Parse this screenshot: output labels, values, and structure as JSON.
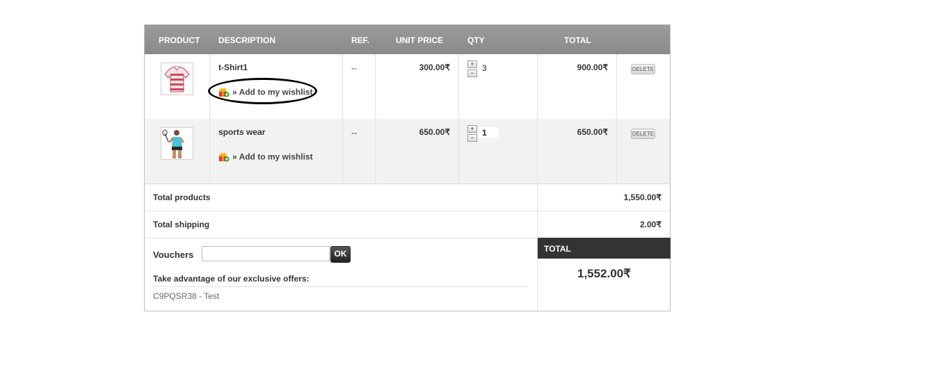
{
  "headers": {
    "product": "PRODUCT",
    "description": "DESCRIPTION",
    "ref": "REF.",
    "unit_price": "UNIT PRICE",
    "qty": "QTY",
    "total": "TOTAL"
  },
  "items": [
    {
      "image_icon": "tshirt-striped-thumbnail",
      "name": "t-Shirt1",
      "wishlist": "» Add to my wishlist",
      "ref": "--",
      "unit_price": "300.00₹",
      "qty": "3",
      "total": "900.00₹",
      "delete": "DELETE"
    },
    {
      "image_icon": "sportswear-athlete-thumbnail",
      "name": "sports wear",
      "wishlist": "» Add to my wishlist",
      "ref": "--",
      "unit_price": "650.00₹",
      "qty": "1",
      "total": "650.00₹",
      "delete": "DELETE"
    }
  ],
  "qty_buttons": {
    "plus": "+",
    "minus": "−"
  },
  "summary": {
    "total_products_label": "Total products",
    "total_products_value": "1,550.00₹",
    "total_shipping_label": "Total shipping",
    "total_shipping_value": "2.00₹"
  },
  "voucher": {
    "label": "Vouchers",
    "value": "",
    "ok": "OK",
    "offers_title": "Take advantage of our exclusive offers:",
    "offer_code": "C9PQSR38",
    "offer_name": " - Test"
  },
  "grand_total": {
    "label": "TOTAL",
    "value": "1,552.00₹"
  },
  "colors": {
    "header_bg": "#929292",
    "total_header_bg": "#333333",
    "ok_button": "#333333",
    "annotation_ellipse": "#000000"
  }
}
